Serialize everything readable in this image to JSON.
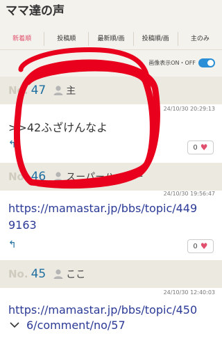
{
  "header": {
    "title": "ママ達の声"
  },
  "tabs": [
    {
      "label": "新着順",
      "active": true
    },
    {
      "label": "投稿順",
      "active": false
    },
    {
      "label": "最新順/画",
      "active": false
    },
    {
      "label": "投稿順/画",
      "active": false
    },
    {
      "label": "主のみ",
      "active": false
    }
  ],
  "image_toggle": {
    "label": "画像表示ON・OFF",
    "state": "on"
  },
  "posts": [
    {
      "no_label": "No.",
      "number": "47",
      "user": "主",
      "timestamp": "24/10/30 20:29:13",
      "content": ">>42ふざけんなよ",
      "likes": "0"
    },
    {
      "no_label": "No.",
      "number": "46",
      "user": "スーパーハッカー",
      "timestamp": "24/10/30 19:56:47",
      "content_line1": "https://mamastar.jp/bbs/topic/449",
      "content_line2": "9163",
      "likes": "0"
    },
    {
      "no_label": "No.",
      "number": "45",
      "user": "ここ",
      "timestamp": "24/10/30 12:40:03",
      "content_line1": "https://mamastar.jp/bbs/topic/450",
      "content_line2": "6/comment/no/57"
    }
  ],
  "colors": {
    "accent": "#e04f6e",
    "number": "#1e6ea0",
    "link": "#2b3a96",
    "toggle": "#2a8fd6",
    "annotation": "#e8001c"
  }
}
